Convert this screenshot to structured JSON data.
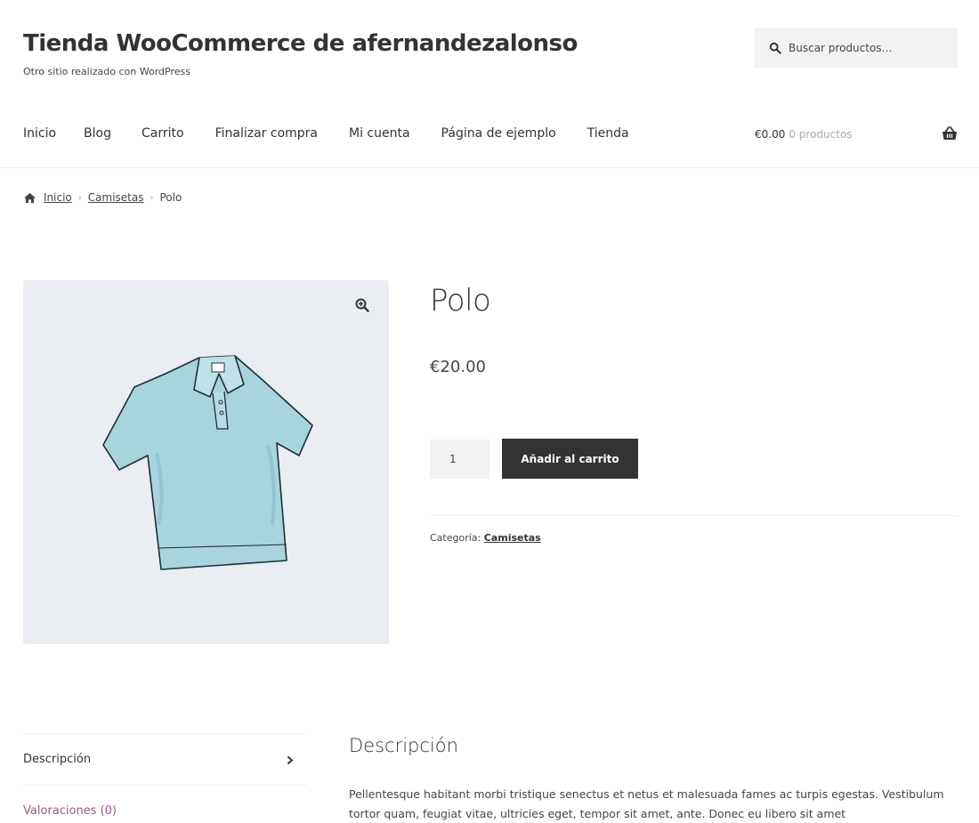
{
  "site": {
    "title": "Tienda WooCommerce de afernandezalonso",
    "tagline": "Otro sitio realizado con WordPress"
  },
  "search": {
    "placeholder": "Buscar productos…",
    "icon": "search-icon"
  },
  "nav": {
    "items": [
      {
        "label": "Inicio"
      },
      {
        "label": "Blog"
      },
      {
        "label": "Carrito"
      },
      {
        "label": "Finalizar compra"
      },
      {
        "label": "Mi cuenta"
      },
      {
        "label": "Página de ejemplo"
      },
      {
        "label": "Tienda"
      }
    ]
  },
  "cart": {
    "amount": "€0.00",
    "count": "0 productos",
    "icon": "basket-icon"
  },
  "breadcrumb": {
    "home": "Inicio",
    "category": "Camisetas",
    "current": "Polo",
    "separator": "›"
  },
  "product": {
    "title": "Polo",
    "price": "€20.00",
    "quantity": "1",
    "add_to_cart": "Añadir al carrito",
    "category_label": "Categoría:",
    "category": "Camisetas",
    "image_bg": "#eaedf1",
    "shirt_color": "#a7d4dd"
  },
  "tabs": {
    "items": [
      {
        "label": "Descripción"
      },
      {
        "label": "Valoraciones (0)"
      }
    ]
  },
  "description": {
    "heading": "Descripción",
    "text": "Pellentesque habitant morbi tristique senectus et netus et malesuada fames ac turpis egestas. Vestibulum tortor quam, feugiat vitae, ultricies eget, tempor sit amet, ante. Donec eu libero sit amet"
  },
  "colors": {
    "text": "#43454b",
    "heading": "#333333",
    "button": "#333333",
    "link_alt": "#96588a"
  }
}
